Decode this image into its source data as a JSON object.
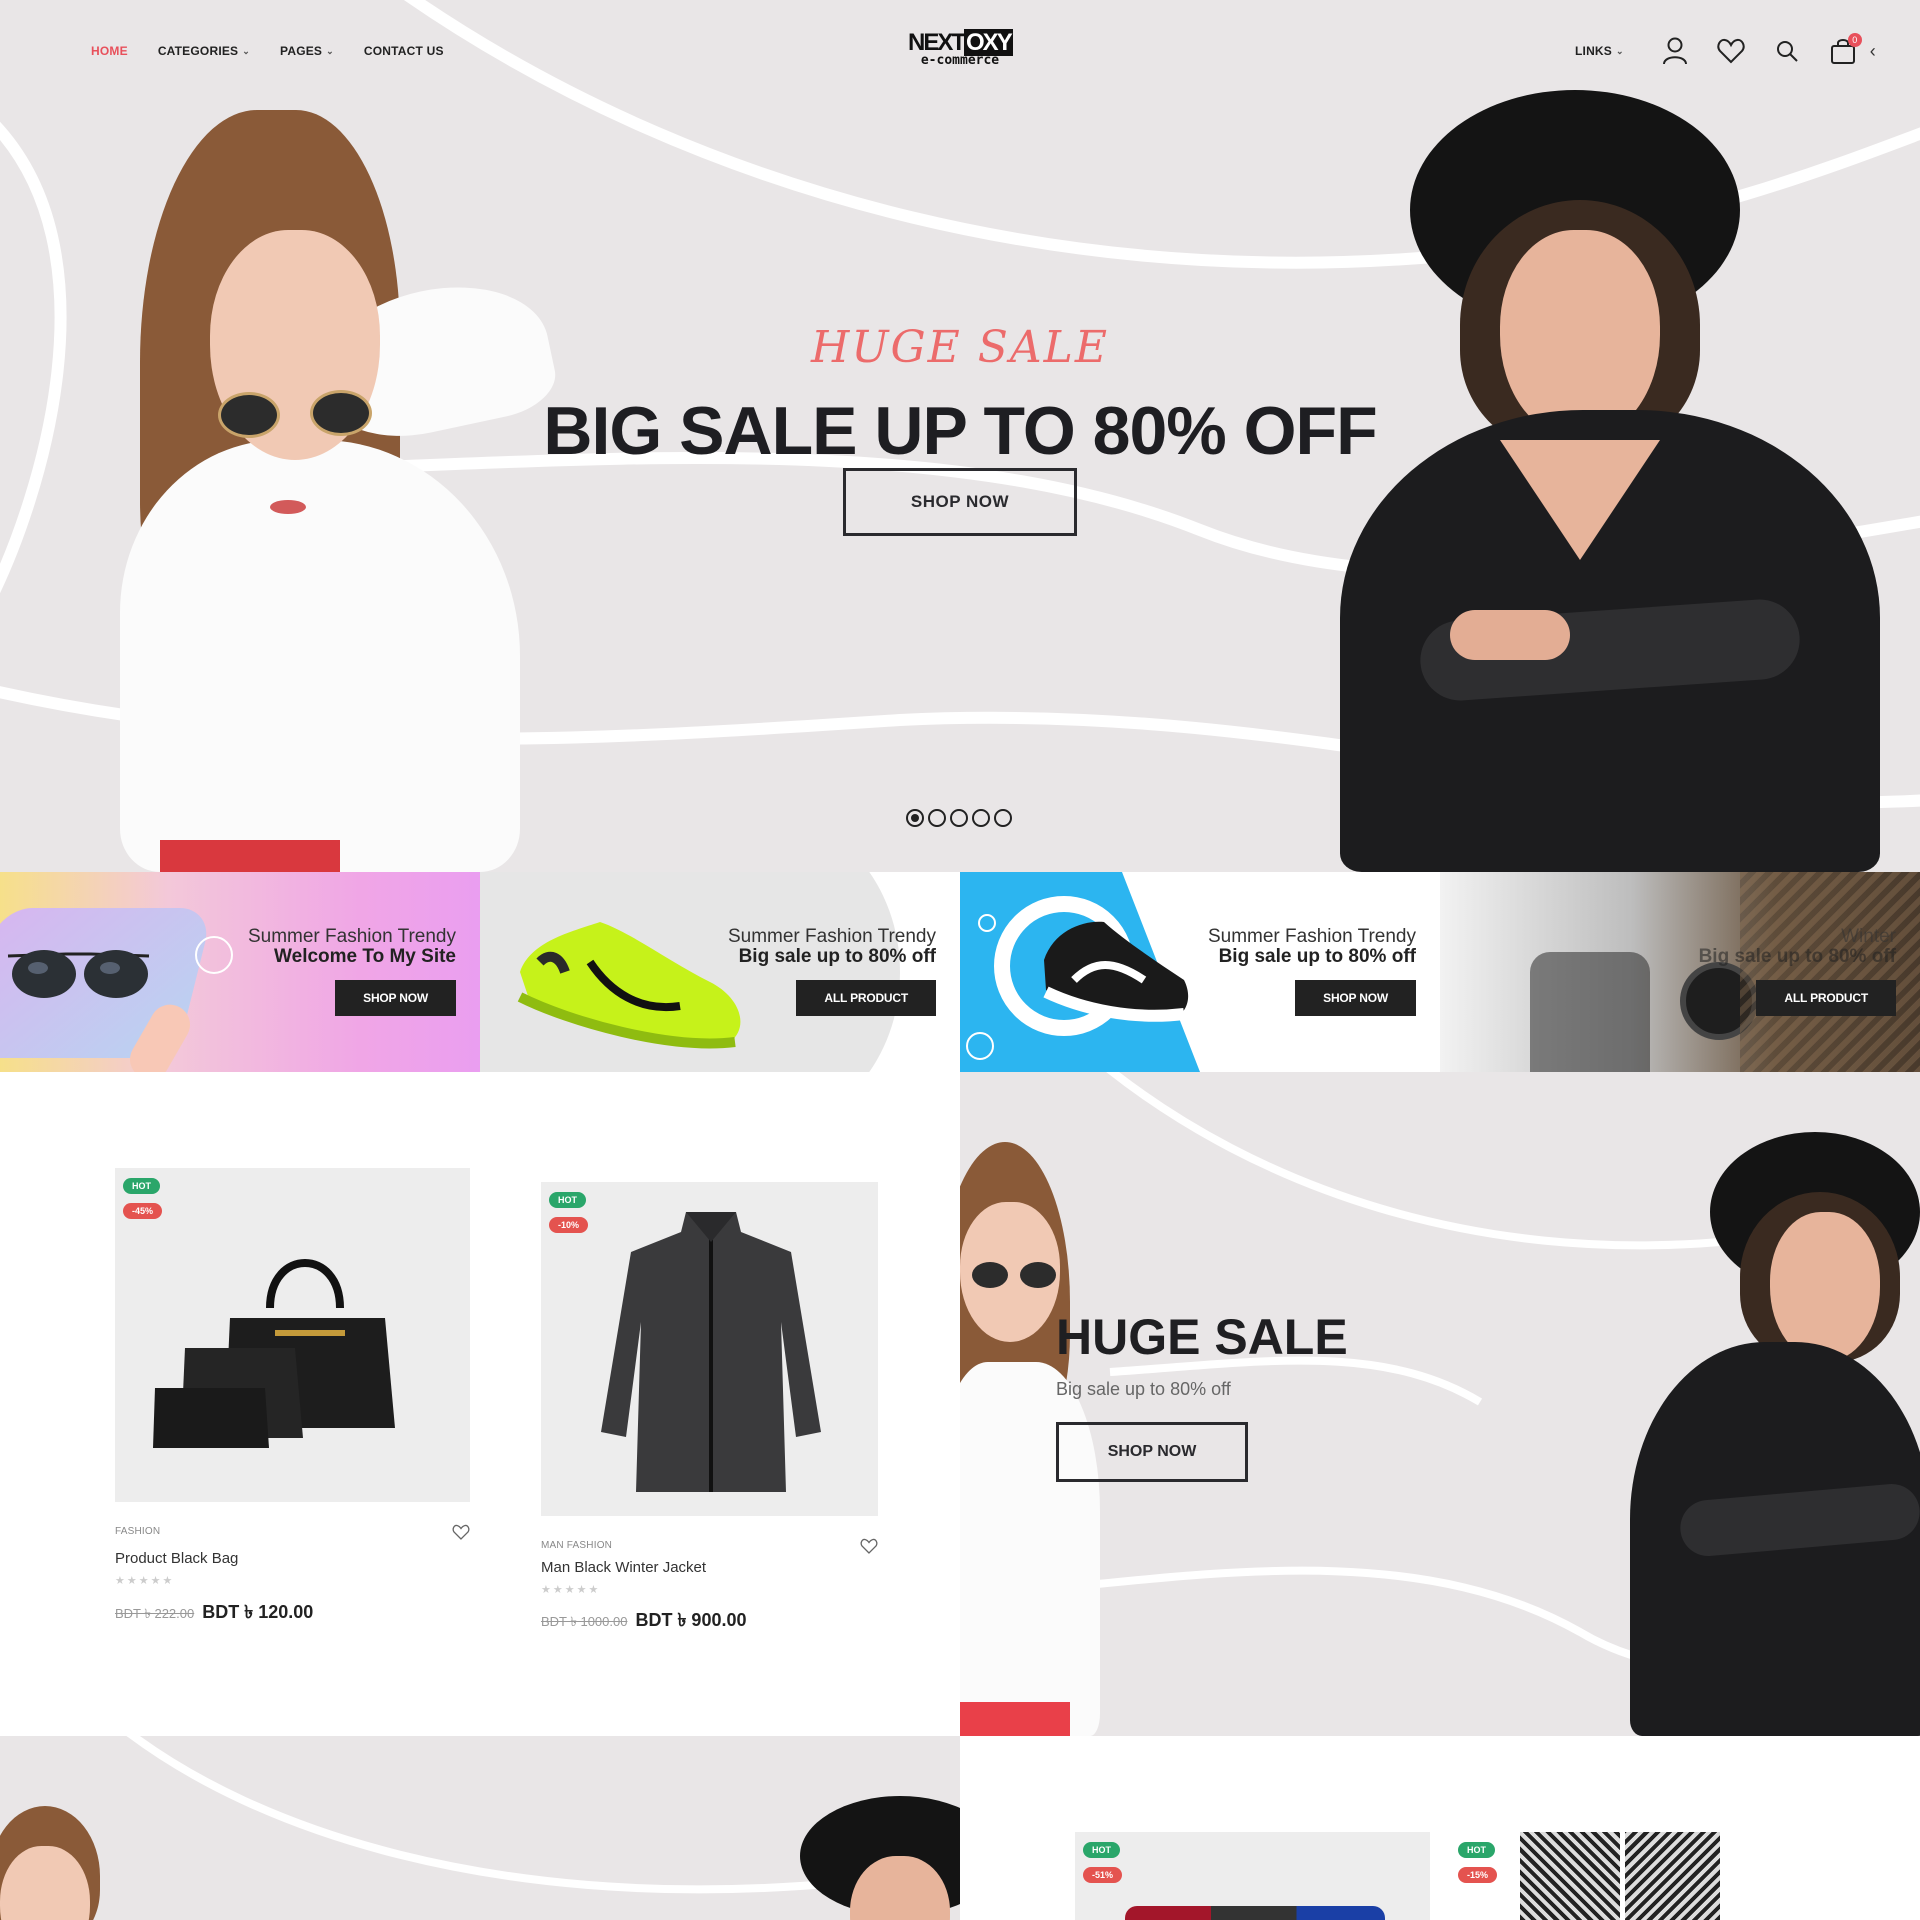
{
  "header": {
    "nav": [
      {
        "label": "HOME",
        "active": true,
        "dropdown": false
      },
      {
        "label": "CATEGORIES",
        "active": false,
        "dropdown": true
      },
      {
        "label": "PAGES",
        "active": false,
        "dropdown": true
      },
      {
        "label": "CONTACT US",
        "active": false,
        "dropdown": false
      }
    ],
    "logo": {
      "top": "NEXT",
      "top_box": "OXY",
      "bottom": "e-commerce"
    },
    "links_label": "LINKS",
    "cart_count": "0",
    "icons": [
      "user-icon",
      "heart-icon",
      "search-icon",
      "cart-icon",
      "chevron-left-icon"
    ]
  },
  "hero": {
    "subtitle": "HUGE SALE",
    "title": "BIG SALE UP TO 80% OFF",
    "button": "SHOP NOW",
    "slides": 5,
    "active_slide": 1
  },
  "banners": [
    {
      "line1": "Summer Fashion Trendy",
      "line2": "Welcome To My Site",
      "button": "SHOP NOW",
      "image": "sunglasses"
    },
    {
      "line1": "Summer Fashion Trendy",
      "line2": "Big sale up to 80% off",
      "button": "ALL PRODUCT",
      "image": "green-sneaker"
    },
    {
      "line1": "Summer Fashion Trendy",
      "line2": "Big sale up to 80% off",
      "button": "SHOP NOW",
      "image": "black-sneaker"
    },
    {
      "line1": "Winter",
      "line2": "Big sale up to 80% off",
      "button": "ALL PRODUCT",
      "image": "watch"
    }
  ],
  "products": [
    {
      "badge_hot": "HOT",
      "badge_off": "-45%",
      "category": "FASHION",
      "name": "Product Black Bag",
      "old_price": "BDT ৳ 222.00",
      "new_price": "BDT ৳ 120.00",
      "stars": "★★★★★"
    },
    {
      "badge_hot": "HOT",
      "badge_off": "-10%",
      "category": "MAN FASHION",
      "name": "Man Black Winter Jacket",
      "old_price": "BDT ৳ 1000.00",
      "new_price": "BDT ৳ 900.00",
      "stars": "★★★★★"
    }
  ],
  "promo": {
    "title": "HUGE SALE",
    "subtitle": "Big sale up to 80% off",
    "button": "SHOP NOW"
  },
  "bottom_products": [
    {
      "badge_hot": "HOT",
      "badge_off": "-51%"
    },
    {
      "badge_hot": "HOT",
      "badge_off": "-15%"
    }
  ],
  "colors": {
    "accent": "#e8505b",
    "hot": "#2aa66a",
    "off": "#e4534f",
    "hero_bg": "#e9e6e7",
    "dark": "#222222"
  }
}
